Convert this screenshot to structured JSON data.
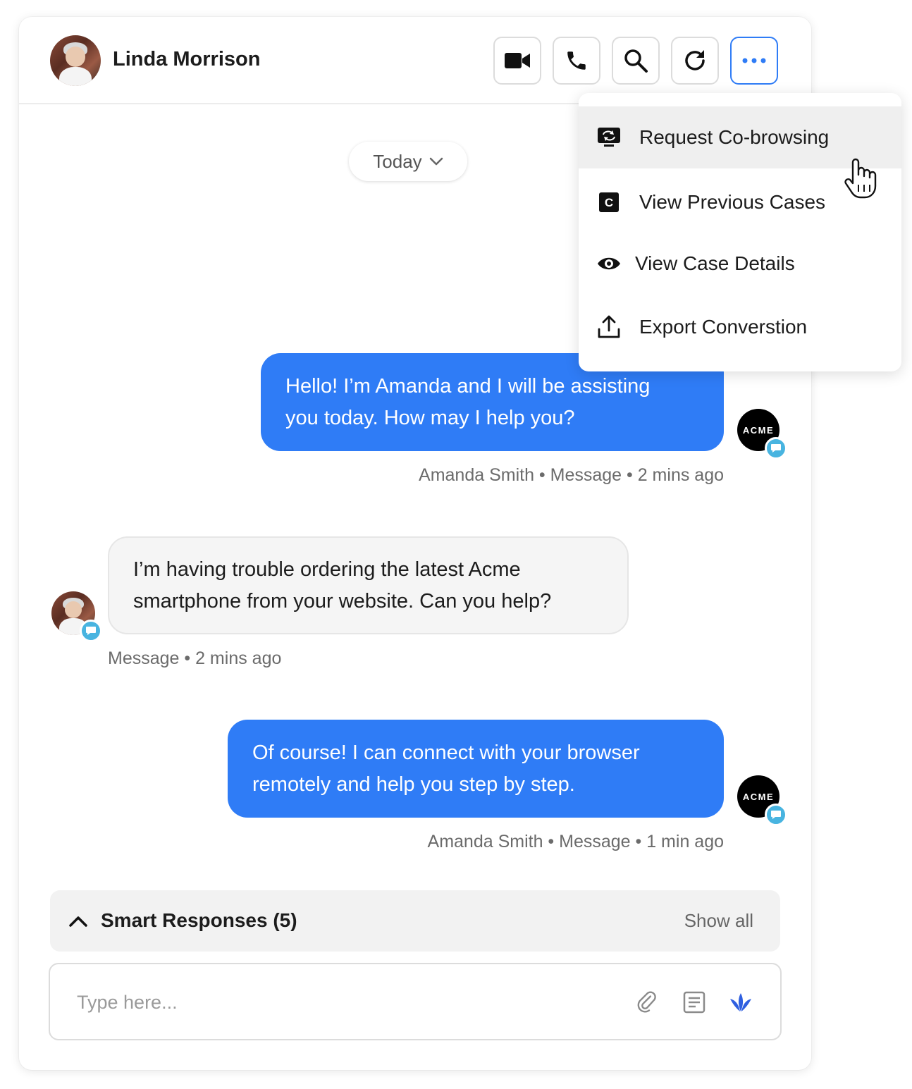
{
  "header": {
    "contact_name": "Linda Morrison",
    "buttons": [
      "video-call",
      "voice-call",
      "search",
      "refresh",
      "more-options"
    ]
  },
  "conversation": {
    "date_filter": "Today"
  },
  "menu": {
    "items": [
      {
        "label": "Request Co-browsing",
        "icon": "cobrowse-icon"
      },
      {
        "label": "View Previous Cases",
        "icon": "case-icon"
      },
      {
        "label": "View Case Details",
        "icon": "eye-icon"
      },
      {
        "label": "Export Converstion",
        "icon": "export-icon"
      }
    ]
  },
  "messages": [
    {
      "direction": "outgoing",
      "line1": "Hello! I’m Amanda and I will be assisting",
      "line2": "you today. How may I help you?",
      "meta": "Amanda Smith • Message • 2 mins ago",
      "avatar_text": "ACME"
    },
    {
      "direction": "incoming",
      "line1": "I’m having trouble ordering the latest Acme",
      "line2": "smartphone from your website. Can you help?",
      "meta": "Message • 2 mins ago"
    },
    {
      "direction": "outgoing",
      "line1": "Of course! I can connect with your browser",
      "line2": "remotely and help you step by step.",
      "meta": "Amanda Smith • Message • 1 min ago",
      "avatar_text": "ACME"
    }
  ],
  "smart_responses": {
    "title": "Smart Responses (5)",
    "show_all": "Show all"
  },
  "composer": {
    "placeholder": "Type here...",
    "icons": [
      "attachment-icon",
      "template-icon",
      "ai-assist-icon"
    ]
  },
  "colors": {
    "accent": "#2f7cf6",
    "outgoing_bubble": "#2f7cf6",
    "incoming_bubble": "#f5f5f5",
    "chat_badge": "#48b4e0"
  }
}
